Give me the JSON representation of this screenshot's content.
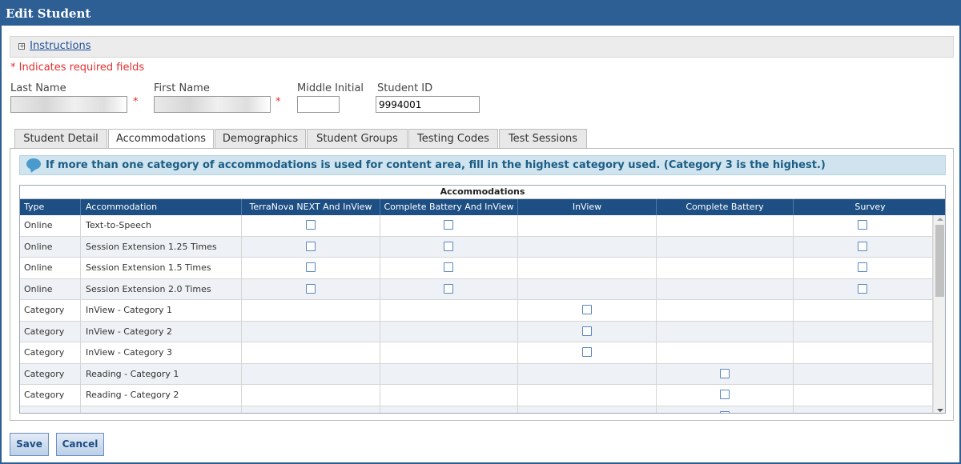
{
  "window": {
    "title": "Edit Student"
  },
  "instructions": {
    "link_label": "Instructions",
    "expand_glyph": "+"
  },
  "required_note": "* Indicates required fields",
  "fields": {
    "last_name": {
      "label": "Last Name",
      "value": ""
    },
    "first_name": {
      "label": "First Name",
      "value": ""
    },
    "middle_initial": {
      "label": "Middle Initial",
      "value": ""
    },
    "student_id": {
      "label": "Student ID",
      "value": "9994001"
    },
    "required_marker": "*"
  },
  "tabs": [
    {
      "label": "Student Detail",
      "active": false
    },
    {
      "label": "Accommodations",
      "active": true
    },
    {
      "label": "Demographics",
      "active": false
    },
    {
      "label": "Student Groups",
      "active": false
    },
    {
      "label": "Testing Codes",
      "active": false
    },
    {
      "label": "Test Sessions",
      "active": false
    }
  ],
  "notice": "If more than one category of accommodations is used for content area, fill in the highest category used. (Category 3 is the highest.)",
  "grid": {
    "caption": "Accommodations",
    "columns": [
      "Type",
      "Accommodation",
      "TerraNova NEXT And InView",
      "Complete Battery And InView",
      "InView",
      "Complete Battery",
      "Survey"
    ],
    "rows": [
      {
        "type": "Online",
        "accommodation": "Text-to-Speech",
        "checks": [
          true,
          true,
          false,
          false,
          true
        ]
      },
      {
        "type": "Online",
        "accommodation": "Session Extension 1.25 Times",
        "checks": [
          true,
          true,
          false,
          false,
          true
        ]
      },
      {
        "type": "Online",
        "accommodation": "Session Extension 1.5 Times",
        "checks": [
          true,
          true,
          false,
          false,
          true
        ]
      },
      {
        "type": "Online",
        "accommodation": "Session Extension 2.0 Times",
        "checks": [
          true,
          true,
          false,
          false,
          true
        ]
      },
      {
        "type": "Category",
        "accommodation": "InView - Category 1",
        "checks": [
          false,
          false,
          true,
          false,
          false
        ]
      },
      {
        "type": "Category",
        "accommodation": "InView - Category 2",
        "checks": [
          false,
          false,
          true,
          false,
          false
        ]
      },
      {
        "type": "Category",
        "accommodation": "InView - Category 3",
        "checks": [
          false,
          false,
          true,
          false,
          false
        ]
      },
      {
        "type": "Category",
        "accommodation": "Reading - Category 1",
        "checks": [
          false,
          false,
          false,
          true,
          false
        ]
      },
      {
        "type": "Category",
        "accommodation": "Reading - Category 2",
        "checks": [
          false,
          false,
          false,
          true,
          false
        ]
      },
      {
        "type": "",
        "accommodation": "",
        "checks": [
          false,
          false,
          false,
          true,
          false
        ]
      }
    ]
  },
  "buttons": {
    "save": "Save",
    "cancel": "Cancel"
  },
  "colors": {
    "titlebar": "#2e5f94",
    "grid_header": "#1d4f84",
    "required": "#e03030",
    "notice_bg": "#cfe4ee"
  }
}
